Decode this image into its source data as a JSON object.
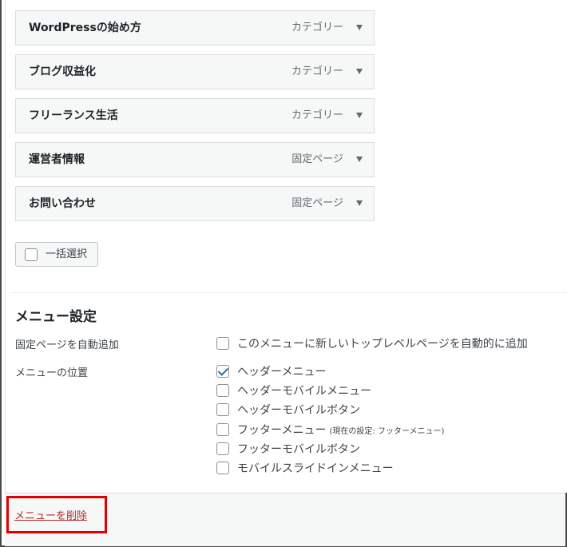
{
  "menu_items": [
    {
      "title": "WordPressの始め方",
      "type": "カテゴリー"
    },
    {
      "title": "ブログ収益化",
      "type": "カテゴリー"
    },
    {
      "title": "フリーランス生活",
      "type": "カテゴリー"
    },
    {
      "title": "運営者情報",
      "type": "固定ページ"
    },
    {
      "title": "お問い合わせ",
      "type": "固定ページ"
    }
  ],
  "bulk_select": {
    "label": "一括選択",
    "checked": false
  },
  "menu_settings": {
    "heading": "メニュー設定",
    "auto_add": {
      "label": "固定ページを自動追加",
      "option": {
        "label": "このメニューに新しいトップレベルページを自動的に追加",
        "checked": false
      }
    },
    "locations": {
      "label": "メニューの位置",
      "options": [
        {
          "label": "ヘッダーメニュー",
          "checked": true,
          "note": ""
        },
        {
          "label": "ヘッダーモバイルメニュー",
          "checked": false,
          "note": ""
        },
        {
          "label": "ヘッダーモバイルボタン",
          "checked": false,
          "note": ""
        },
        {
          "label": "フッターメニュー",
          "checked": false,
          "note": "(現在の設定: フッターメニュー)"
        },
        {
          "label": "フッターモバイルボタン",
          "checked": false,
          "note": ""
        },
        {
          "label": "モバイルスライドインメニュー",
          "checked": false,
          "note": ""
        }
      ]
    }
  },
  "footer": {
    "delete_label": "メニューを削除"
  },
  "colors": {
    "delete_link": "#b32d2e",
    "highlight_box": "#e00000",
    "checkbox_check": "#2271b1"
  }
}
